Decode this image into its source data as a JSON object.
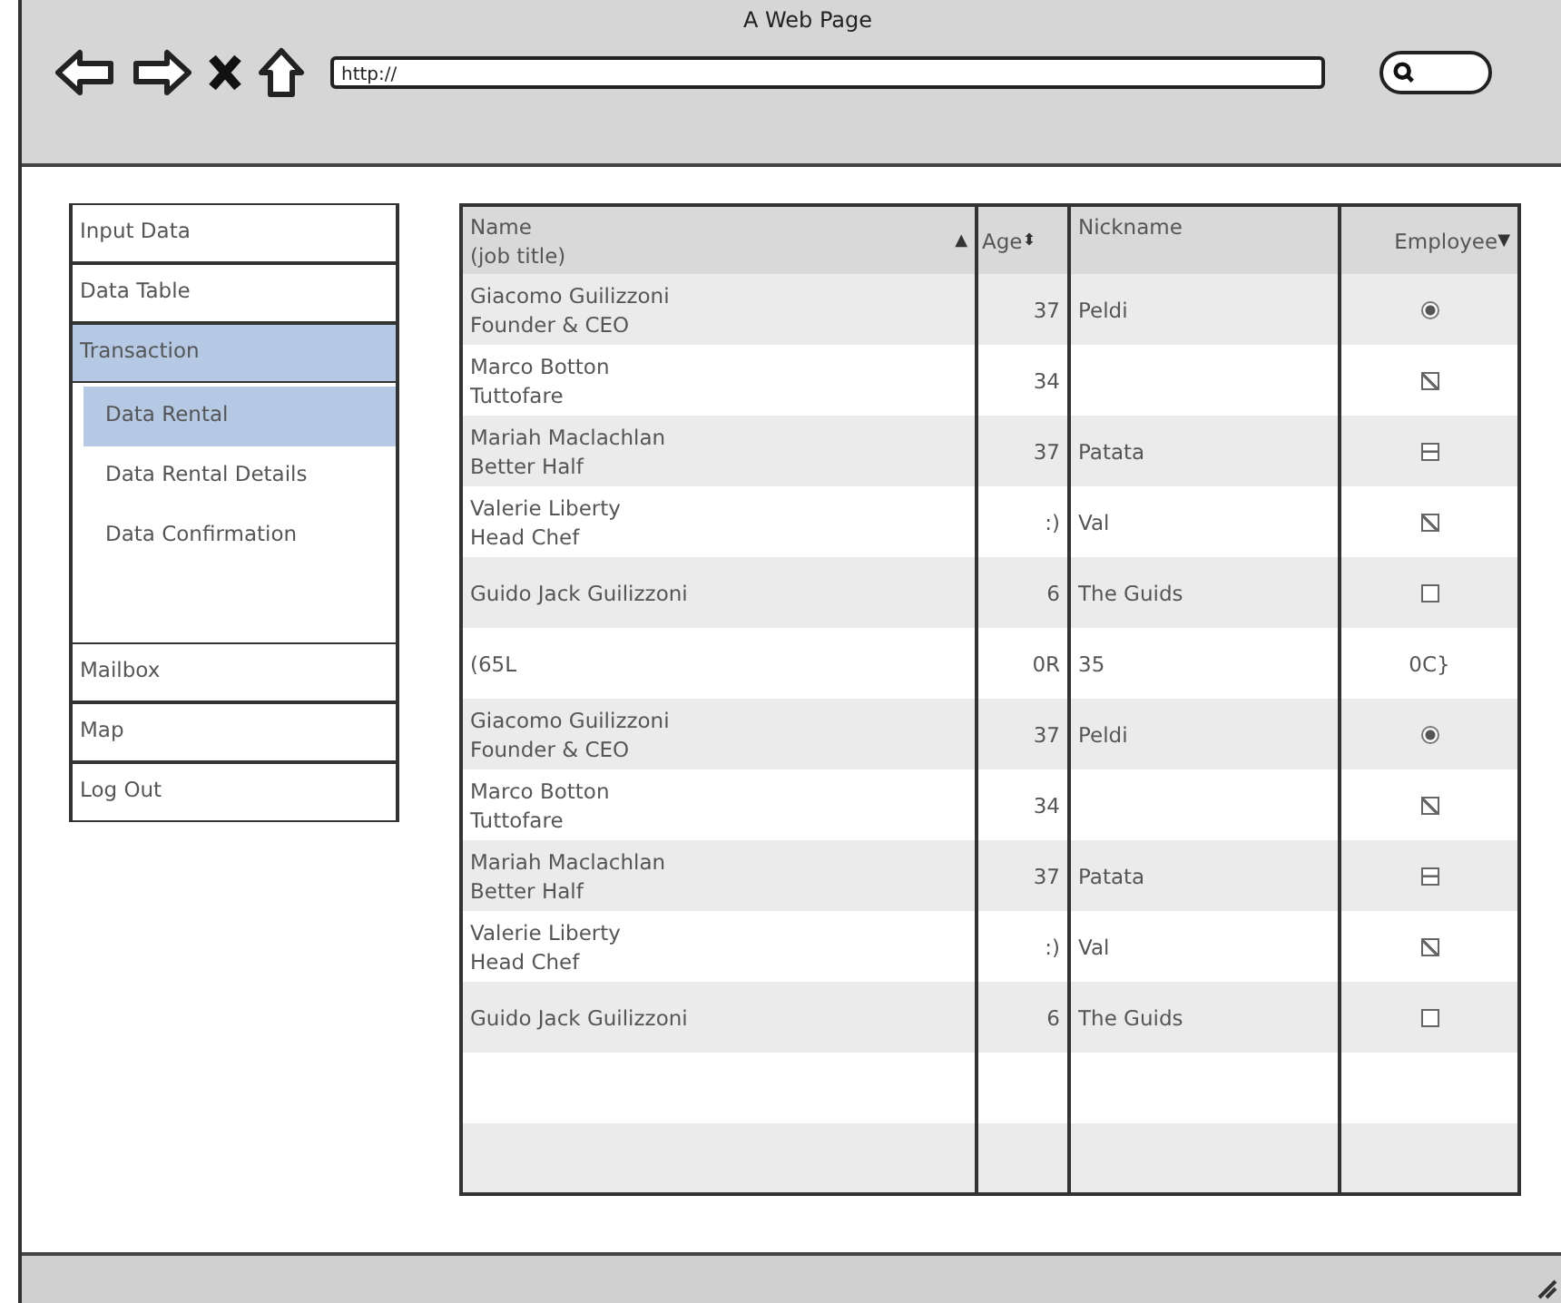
{
  "window": {
    "title": "A Web Page"
  },
  "toolbar": {
    "url": {
      "value": "http://"
    }
  },
  "sidebar": {
    "items": [
      {
        "label": "Input Data",
        "selected": false
      },
      {
        "label": "Data Table",
        "selected": false
      },
      {
        "label": "Transaction",
        "selected": true,
        "expanded": true,
        "children": [
          {
            "label": "Data Rental",
            "selected": true
          },
          {
            "label": "Data Rental Details",
            "selected": false
          },
          {
            "label": "Data Confirmation",
            "selected": false
          }
        ]
      },
      {
        "label": "Mailbox",
        "selected": false
      },
      {
        "label": "Map",
        "selected": false
      },
      {
        "label": "Log Out",
        "selected": false
      }
    ]
  },
  "table": {
    "columns": [
      {
        "label": "Name\n(job title)",
        "sort": "▲"
      },
      {
        "label": "Age",
        "sort": "⬍"
      },
      {
        "label": "Nickname"
      },
      {
        "label": "Employee",
        "sort": "▼"
      }
    ],
    "rows": [
      {
        "name": "Giacomo Guilizzoni\nFounder & CEO",
        "age": "37",
        "nickname": "Peldi",
        "employee": {
          "kind": "radio",
          "selected": true
        }
      },
      {
        "name": "Marco Botton\nTuttofare",
        "age": "34",
        "employee": {
          "kind": "checkbox",
          "checked": true
        }
      },
      {
        "name": "Mariah Maclachlan\nBetter Half",
        "age": "37",
        "nickname": "Patata",
        "employee": {
          "kind": "mixed"
        }
      },
      {
        "name": "Valerie Liberty\nHead Chef",
        "age": ":)",
        "nickname": "Val",
        "employee": {
          "kind": "checkbox",
          "checked": true
        }
      },
      {
        "name": "Guido Jack Guilizzoni",
        "age": "6",
        "nickname": "The Guids",
        "employee": {
          "kind": "checkbox",
          "checked": false
        }
      },
      {
        "name": "(65L",
        "age": "0R",
        "nickname": "35",
        "employee": {
          "kind": "text",
          "text": "0C}"
        }
      },
      {
        "name": "Giacomo Guilizzoni\nFounder & CEO",
        "age": "37",
        "nickname": "Peldi",
        "employee": {
          "kind": "radio",
          "selected": true
        }
      },
      {
        "name": "Marco Botton\nTuttofare",
        "age": "34",
        "employee": {
          "kind": "checkbox",
          "checked": true
        }
      },
      {
        "name": "Mariah Maclachlan\nBetter Half",
        "age": "37",
        "nickname": "Patata",
        "employee": {
          "kind": "mixed"
        }
      },
      {
        "name": "Valerie Liberty\nHead Chef",
        "age": ":)",
        "nickname": "Val",
        "employee": {
          "kind": "checkbox",
          "checked": true
        }
      },
      {
        "name": "Guido Jack Guilizzoni",
        "age": "6",
        "nickname": "The Guids",
        "employee": {
          "kind": "checkbox",
          "checked": false
        }
      }
    ]
  }
}
